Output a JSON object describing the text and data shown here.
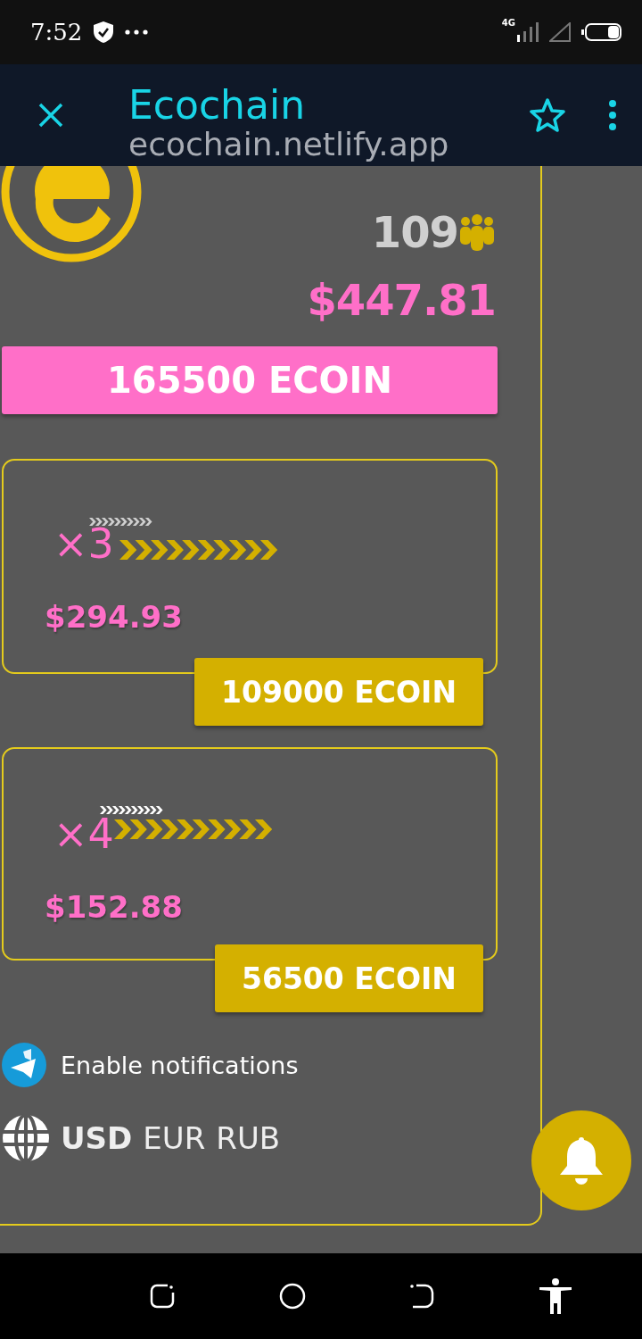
{
  "status_bar": {
    "time": "7:52",
    "network": "4G"
  },
  "browser_bar": {
    "title": "Ecochain",
    "url": "ecochain.netlify.app"
  },
  "stats": {
    "participants": "109",
    "total_value": "$447.81"
  },
  "main_button": "165500 ECOIN",
  "offers": [
    {
      "multiplier": "×3",
      "value": "$294.93",
      "button": "109000 ECOIN"
    },
    {
      "multiplier": "×4",
      "value": "$152.88",
      "button": "56500 ECOIN"
    }
  ],
  "notifications_link": "Enable notifications",
  "currencies": [
    {
      "label": "USD",
      "selected": true
    },
    {
      "label": "EUR",
      "selected": false
    },
    {
      "label": "RUB",
      "selected": false
    }
  ]
}
